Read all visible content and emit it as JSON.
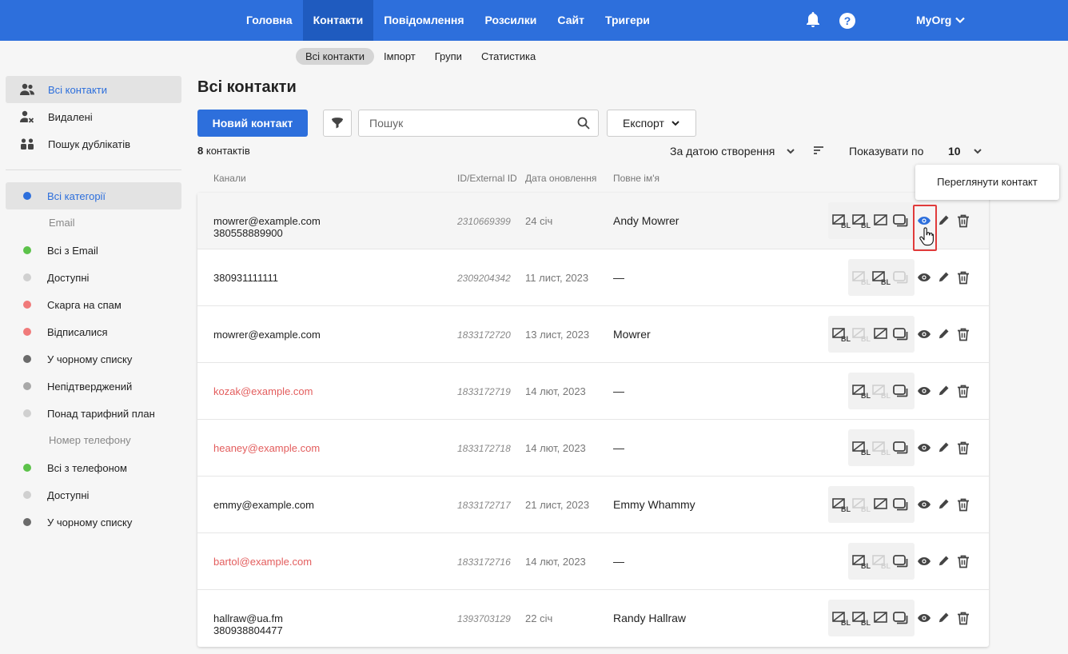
{
  "topbar": {
    "nav": [
      "Головна",
      "Контакти",
      "Повідомлення",
      "Розсилки",
      "Сайт",
      "Тригери"
    ],
    "active": "Контакти",
    "org": "MyOrg",
    "help_glyph": "?"
  },
  "subnav": {
    "items": [
      "Всі контакти",
      "Імпорт",
      "Групи",
      "Статистика"
    ],
    "active": "Всі контакти"
  },
  "sidebar": {
    "top": [
      {
        "label": "Всі контакти",
        "icon": "users-icon"
      },
      {
        "label": "Видалені",
        "icon": "user-remove-icon"
      },
      {
        "label": "Пошук дублікатів",
        "icon": "duplicates-icon"
      }
    ],
    "all_categories": "Всі категорії",
    "email_group": "Email",
    "email_items": [
      {
        "label": "Всі з Email",
        "color": "#5cc24a"
      },
      {
        "label": "Доступні",
        "color": "#d0d0d0"
      },
      {
        "label": "Скарга на спам",
        "color": "#f07a7a"
      },
      {
        "label": "Відписалися",
        "color": "#f07a7a"
      },
      {
        "label": "У чорному списку",
        "color": "#6b6b6b"
      },
      {
        "label": "Непідтверджений",
        "color": "#a8a8a8"
      },
      {
        "label": "Понад тарифний план",
        "color": "#d0d0d0"
      }
    ],
    "phone_group": "Номер телефону",
    "phone_items": [
      {
        "label": "Всі з телефоном",
        "color": "#5cc24a"
      },
      {
        "label": "Доступні",
        "color": "#d0d0d0"
      },
      {
        "label": "У чорному списку",
        "color": "#6b6b6b"
      }
    ]
  },
  "main": {
    "title": "Всі контакти",
    "new_button": "Новий контакт",
    "search_placeholder": "Пошук",
    "export_button": "Експорт",
    "count_number": "8",
    "count_label": "контактів",
    "sort_label": "За датою створення",
    "per_page_label": "Показувати по",
    "per_page_value": "10",
    "tooltip": "Переглянути контакт"
  },
  "columns": {
    "channels": "Канали",
    "id": "ID/External ID",
    "date": "Дата оновлення",
    "name": "Повне ім'я"
  },
  "rows": [
    {
      "ch1": "mowrer@example.com",
      "ch2": "380558889900",
      "red": false,
      "id": "2310669399",
      "date": "24 січ",
      "name": "Andy Mowrer",
      "icons": [
        1,
        1,
        1,
        1
      ]
    },
    {
      "ch1": "380931111111",
      "ch2": "",
      "red": false,
      "id": "2309204342",
      "date": "11 лист, 2023",
      "name": "—",
      "icons": [
        0,
        1,
        0
      ]
    },
    {
      "ch1": "mowrer@example.com",
      "ch2": "",
      "red": false,
      "id": "1833172720",
      "date": "13 лист, 2023",
      "name": "Mowrer",
      "icons": [
        1,
        0,
        1,
        1
      ]
    },
    {
      "ch1": "kozak@example.com",
      "ch2": "",
      "red": true,
      "id": "1833172719",
      "date": "14 лют, 2023",
      "name": "—",
      "icons": [
        1,
        0,
        1
      ]
    },
    {
      "ch1": "heaney@example.com",
      "ch2": "",
      "red": true,
      "id": "1833172718",
      "date": "14 лют, 2023",
      "name": "—",
      "icons": [
        1,
        0,
        1
      ]
    },
    {
      "ch1": "emmy@example.com",
      "ch2": "",
      "red": false,
      "id": "1833172717",
      "date": "21 лист, 2023",
      "name": "Emmy Whammy",
      "icons": [
        1,
        0,
        1,
        1
      ]
    },
    {
      "ch1": "bartol@example.com",
      "ch2": "",
      "red": true,
      "id": "1833172716",
      "date": "14 лют, 2023",
      "name": "—",
      "icons": [
        1,
        0,
        1
      ]
    },
    {
      "ch1": "hallraw@ua.fm",
      "ch2": "380938804477",
      "red": false,
      "id": "1393703129",
      "date": "22 січ",
      "name": "Randy Hallraw",
      "icons": [
        1,
        1,
        1,
        1
      ]
    }
  ]
}
